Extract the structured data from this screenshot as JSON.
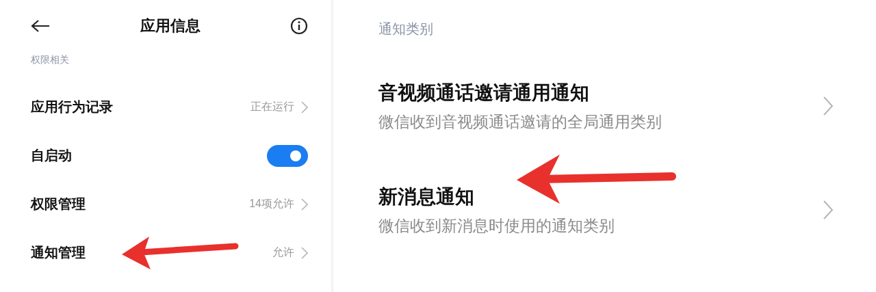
{
  "app_info": {
    "title": "应用信息",
    "section": "权限相关",
    "rows": [
      {
        "kind": "link",
        "label": "应用行为记录",
        "value": "正在运行"
      },
      {
        "kind": "toggle",
        "label": "自启动",
        "on": true
      },
      {
        "kind": "link",
        "label": "权限管理",
        "value": "14项允许"
      },
      {
        "kind": "link",
        "label": "通知管理",
        "value": "允许"
      }
    ]
  },
  "notification_categories": {
    "section": "通知类别",
    "items": [
      {
        "title": "音视频通话邀请通用通知",
        "description": "微信收到音视频通话邀请的全局通用类别"
      },
      {
        "title": "新消息通知",
        "description": "微信收到新消息时使用的通知类别"
      }
    ]
  }
}
